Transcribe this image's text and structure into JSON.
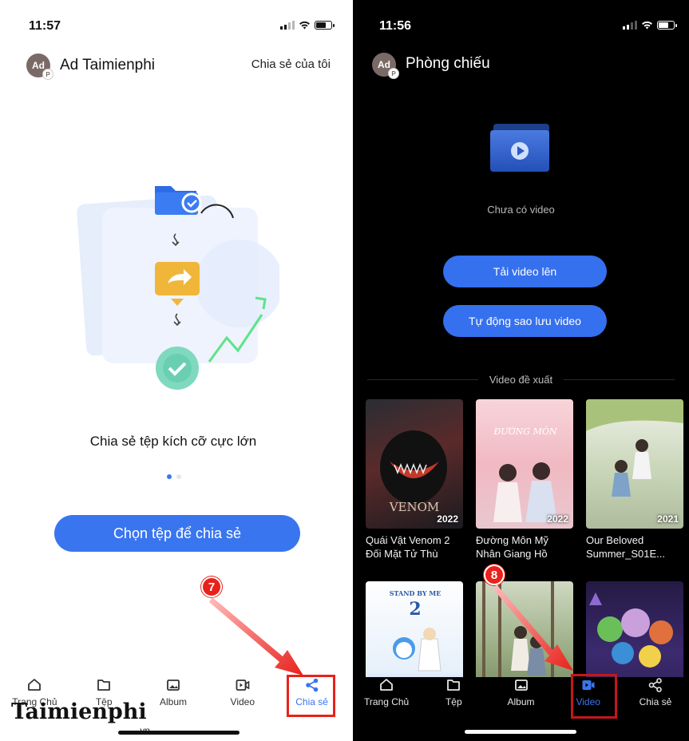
{
  "left": {
    "status": {
      "time": "11:57"
    },
    "header": {
      "avatar": "Ad",
      "name": "Ad Taimienphi",
      "share_link": "Chia sẻ của tôi"
    },
    "slogan": "Chia sẻ tệp kích cỡ cực lớn",
    "carousel": {
      "pages": 2,
      "current": 1
    },
    "primary_button": "Chọn tệp để chia sẻ",
    "tabs": [
      {
        "label": "Trang Chủ",
        "icon": "home-icon"
      },
      {
        "label": "Tệp",
        "icon": "folder-icon"
      },
      {
        "label": "Album",
        "icon": "image-icon"
      },
      {
        "label": "Video",
        "icon": "video-icon"
      },
      {
        "label": "Chia sẻ",
        "icon": "share-icon",
        "active": true
      }
    ],
    "step_marker": "7"
  },
  "right": {
    "status": {
      "time": "11:56"
    },
    "header": {
      "avatar": "Ad",
      "title": "Phòng chiếu"
    },
    "empty_text": "Chưa có video",
    "buttons": {
      "upload": "Tải video lên",
      "auto_backup": "Tự động sao lưu video"
    },
    "suggest_heading": "Video đề xuất",
    "videos": [
      {
        "title": "Quái Vật Venom 2 Đối Mặt Tử Thù",
        "year": "2022",
        "poster": "venom-poster"
      },
      {
        "title": "Đường Môn Mỹ Nhân Giang Hồ",
        "year": "2022",
        "poster": "duong-mon-poster"
      },
      {
        "title": "Our Beloved Summer_S01E...",
        "year": "2021",
        "poster": "our-beloved-summer-poster"
      },
      {
        "title": "",
        "year": "",
        "poster": "stand-by-me-poster"
      },
      {
        "title": "",
        "year": "",
        "poster": "forest-couple-poster"
      },
      {
        "title": "",
        "year": "",
        "poster": "animation-poster"
      }
    ],
    "tabs": [
      {
        "label": "Trang Chủ",
        "icon": "home-icon"
      },
      {
        "label": "Tệp",
        "icon": "folder-icon"
      },
      {
        "label": "Album",
        "icon": "image-icon"
      },
      {
        "label": "Video",
        "icon": "video-icon",
        "active": true
      },
      {
        "label": "Chia sẻ",
        "icon": "share-icon"
      }
    ],
    "step_marker": "8"
  },
  "watermark": {
    "brand": "Taimienphi",
    "suffix": ".vn"
  },
  "colors": {
    "accent": "#3a75f0",
    "highlight": "#e8211a",
    "dark_bg": "#000000"
  }
}
